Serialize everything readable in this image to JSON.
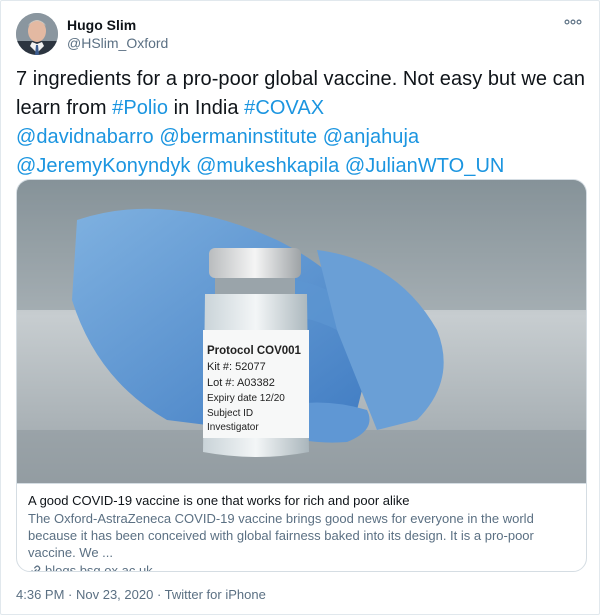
{
  "author": {
    "name": "Hugo Slim",
    "handle": "@HSlim_Oxford"
  },
  "tweet": {
    "text_parts": {
      "p1": "7 ingredients for a pro-poor global vaccine. Not easy but we can learn from ",
      "h1": "#Polio",
      "p2": " in India ",
      "h2": "#COVAX",
      "m1": "@davidnabarro",
      "m2": "@bermaninstitute",
      "m3": "@anjahuja",
      "m4": "@JeremyKonyndyk",
      "m5": "@mukeshkapila",
      "m6": "@JulianWTO_UN"
    }
  },
  "card": {
    "image_vial_label": {
      "title": "Protocol COV001",
      "kit": "Kit #:  52077",
      "lot": "Lot #:  A03382",
      "expiry": "Expiry date  12/20",
      "subject": "Subject ID",
      "investigator": "Investigator"
    },
    "title": "A good COVID-19 vaccine is one that works for rich and poor alike",
    "description": "The Oxford-AstraZeneca COVID-19 vaccine brings good news for everyone in the world because it has been conceived with global fairness baked into its design. It is a pro-poor vaccine. We ...",
    "domain": "blogs.bsg.ox.ac.uk"
  },
  "meta": {
    "time": "4:36 PM",
    "sep1": " · ",
    "date": "Nov 23, 2020",
    "sep2": " · ",
    "source": "Twitter for iPhone"
  },
  "colors": {
    "link": "#1b95e0",
    "secondary": "#5b7083",
    "border": "#d5dde3"
  },
  "icons": [
    "more-icon",
    "link-icon"
  ]
}
